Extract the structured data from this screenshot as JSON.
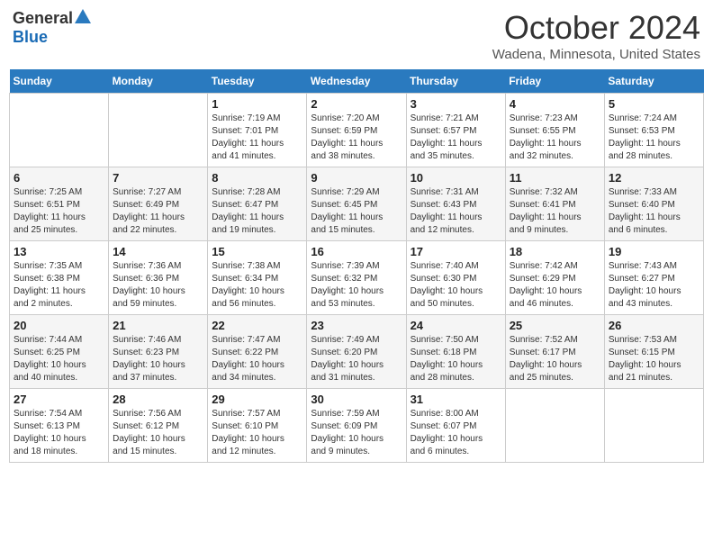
{
  "header": {
    "logo_general": "General",
    "logo_blue": "Blue",
    "title": "October 2024",
    "location": "Wadena, Minnesota, United States"
  },
  "days_of_week": [
    "Sunday",
    "Monday",
    "Tuesday",
    "Wednesday",
    "Thursday",
    "Friday",
    "Saturday"
  ],
  "weeks": [
    [
      {
        "day": "",
        "detail": ""
      },
      {
        "day": "",
        "detail": ""
      },
      {
        "day": "1",
        "detail": "Sunrise: 7:19 AM\nSunset: 7:01 PM\nDaylight: 11 hours\nand 41 minutes."
      },
      {
        "day": "2",
        "detail": "Sunrise: 7:20 AM\nSunset: 6:59 PM\nDaylight: 11 hours\nand 38 minutes."
      },
      {
        "day": "3",
        "detail": "Sunrise: 7:21 AM\nSunset: 6:57 PM\nDaylight: 11 hours\nand 35 minutes."
      },
      {
        "day": "4",
        "detail": "Sunrise: 7:23 AM\nSunset: 6:55 PM\nDaylight: 11 hours\nand 32 minutes."
      },
      {
        "day": "5",
        "detail": "Sunrise: 7:24 AM\nSunset: 6:53 PM\nDaylight: 11 hours\nand 28 minutes."
      }
    ],
    [
      {
        "day": "6",
        "detail": "Sunrise: 7:25 AM\nSunset: 6:51 PM\nDaylight: 11 hours\nand 25 minutes."
      },
      {
        "day": "7",
        "detail": "Sunrise: 7:27 AM\nSunset: 6:49 PM\nDaylight: 11 hours\nand 22 minutes."
      },
      {
        "day": "8",
        "detail": "Sunrise: 7:28 AM\nSunset: 6:47 PM\nDaylight: 11 hours\nand 19 minutes."
      },
      {
        "day": "9",
        "detail": "Sunrise: 7:29 AM\nSunset: 6:45 PM\nDaylight: 11 hours\nand 15 minutes."
      },
      {
        "day": "10",
        "detail": "Sunrise: 7:31 AM\nSunset: 6:43 PM\nDaylight: 11 hours\nand 12 minutes."
      },
      {
        "day": "11",
        "detail": "Sunrise: 7:32 AM\nSunset: 6:41 PM\nDaylight: 11 hours\nand 9 minutes."
      },
      {
        "day": "12",
        "detail": "Sunrise: 7:33 AM\nSunset: 6:40 PM\nDaylight: 11 hours\nand 6 minutes."
      }
    ],
    [
      {
        "day": "13",
        "detail": "Sunrise: 7:35 AM\nSunset: 6:38 PM\nDaylight: 11 hours\nand 2 minutes."
      },
      {
        "day": "14",
        "detail": "Sunrise: 7:36 AM\nSunset: 6:36 PM\nDaylight: 10 hours\nand 59 minutes."
      },
      {
        "day": "15",
        "detail": "Sunrise: 7:38 AM\nSunset: 6:34 PM\nDaylight: 10 hours\nand 56 minutes."
      },
      {
        "day": "16",
        "detail": "Sunrise: 7:39 AM\nSunset: 6:32 PM\nDaylight: 10 hours\nand 53 minutes."
      },
      {
        "day": "17",
        "detail": "Sunrise: 7:40 AM\nSunset: 6:30 PM\nDaylight: 10 hours\nand 50 minutes."
      },
      {
        "day": "18",
        "detail": "Sunrise: 7:42 AM\nSunset: 6:29 PM\nDaylight: 10 hours\nand 46 minutes."
      },
      {
        "day": "19",
        "detail": "Sunrise: 7:43 AM\nSunset: 6:27 PM\nDaylight: 10 hours\nand 43 minutes."
      }
    ],
    [
      {
        "day": "20",
        "detail": "Sunrise: 7:44 AM\nSunset: 6:25 PM\nDaylight: 10 hours\nand 40 minutes."
      },
      {
        "day": "21",
        "detail": "Sunrise: 7:46 AM\nSunset: 6:23 PM\nDaylight: 10 hours\nand 37 minutes."
      },
      {
        "day": "22",
        "detail": "Sunrise: 7:47 AM\nSunset: 6:22 PM\nDaylight: 10 hours\nand 34 minutes."
      },
      {
        "day": "23",
        "detail": "Sunrise: 7:49 AM\nSunset: 6:20 PM\nDaylight: 10 hours\nand 31 minutes."
      },
      {
        "day": "24",
        "detail": "Sunrise: 7:50 AM\nSunset: 6:18 PM\nDaylight: 10 hours\nand 28 minutes."
      },
      {
        "day": "25",
        "detail": "Sunrise: 7:52 AM\nSunset: 6:17 PM\nDaylight: 10 hours\nand 25 minutes."
      },
      {
        "day": "26",
        "detail": "Sunrise: 7:53 AM\nSunset: 6:15 PM\nDaylight: 10 hours\nand 21 minutes."
      }
    ],
    [
      {
        "day": "27",
        "detail": "Sunrise: 7:54 AM\nSunset: 6:13 PM\nDaylight: 10 hours\nand 18 minutes."
      },
      {
        "day": "28",
        "detail": "Sunrise: 7:56 AM\nSunset: 6:12 PM\nDaylight: 10 hours\nand 15 minutes."
      },
      {
        "day": "29",
        "detail": "Sunrise: 7:57 AM\nSunset: 6:10 PM\nDaylight: 10 hours\nand 12 minutes."
      },
      {
        "day": "30",
        "detail": "Sunrise: 7:59 AM\nSunset: 6:09 PM\nDaylight: 10 hours\nand 9 minutes."
      },
      {
        "day": "31",
        "detail": "Sunrise: 8:00 AM\nSunset: 6:07 PM\nDaylight: 10 hours\nand 6 minutes."
      },
      {
        "day": "",
        "detail": ""
      },
      {
        "day": "",
        "detail": ""
      }
    ]
  ]
}
